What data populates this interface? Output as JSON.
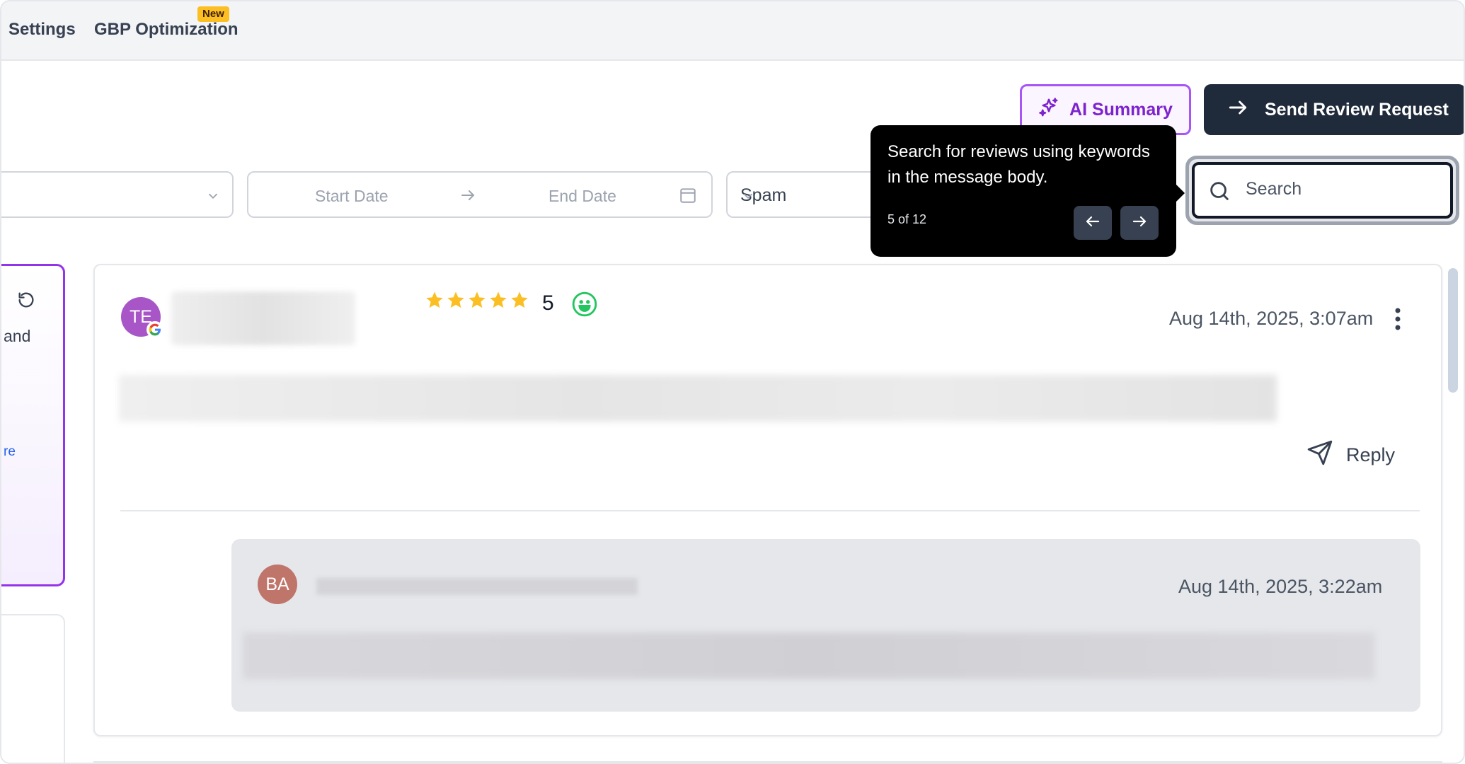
{
  "nav": {
    "settings": "Settings",
    "gbp_optimization": "GBP Optimization",
    "new_badge": "New"
  },
  "header": {
    "ai_summary": "AI Summary",
    "send_review_request": "Send Review Request"
  },
  "filters": {
    "start_date_placeholder": "Start Date",
    "end_date_placeholder": "End Date",
    "spam_select_value": "Spam",
    "search_placeholder": "Search"
  },
  "tooltip": {
    "text": "Search for reviews using keywords in the message body.",
    "step": "5 of 12"
  },
  "left_panel": {
    "partial_text": "and",
    "partial_link": "re"
  },
  "review": {
    "avatar_initials": "TE",
    "source_icon": "google-icon",
    "rating": "5",
    "stars": 5,
    "sentiment_icon": "smile-icon",
    "date": "Aug 14th, 2025, 3:07am",
    "reply_label": "Reply",
    "response": {
      "avatar_initials": "BA",
      "date": "Aug 14th, 2025, 3:22am"
    }
  },
  "colors": {
    "accent_purple": "#a855f7",
    "dark_button": "#1f2a3b",
    "star": "#fbbf24",
    "smile_green": "#22c55e"
  }
}
